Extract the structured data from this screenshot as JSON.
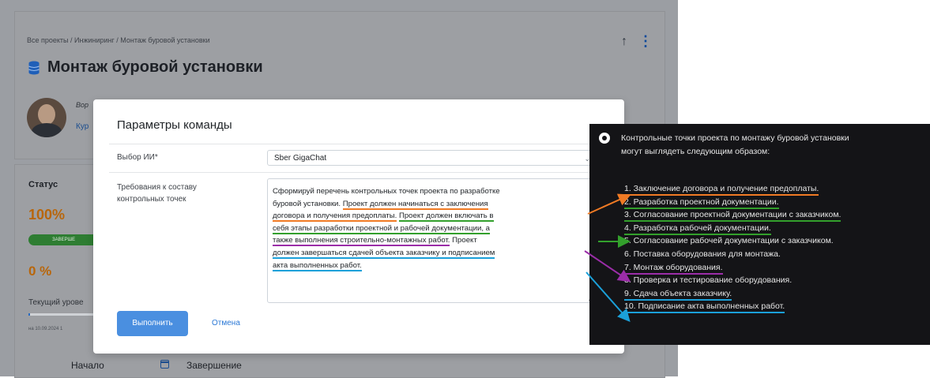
{
  "page": {
    "breadcrumb": "Все проекты / Инжиниринг / Монтаж буровой установки",
    "title": "Монтаж буровой установки",
    "owner_label": "Вор",
    "owner_link": "Кур"
  },
  "icons": {
    "database": "database-icon",
    "up_arrow": "arrow-up-icon",
    "kebab": "kebab-menu-icon",
    "calendar": "calendar-icon"
  },
  "status": {
    "title": "Статус",
    "percent_top": "100%",
    "badge": "ЗАВЕРШЕ",
    "percent_bottom": "0 %",
    "current_level": "Текущий урове",
    "progress_fraction": 0.02,
    "date": "на 10.09.2024 1",
    "start_label": "Начало",
    "end_label": "Завершение"
  },
  "modal": {
    "title": "Параметры команды",
    "ai_label": "Выбор ИИ*",
    "ai_value": "Sber GigaChat",
    "req_label_1": "Требования к составу",
    "req_label_2": "контрольных точек",
    "prompt": {
      "l1": "Сформируй перечень контрольных точек проекта по разработке",
      "l2a": "буровой установки. ",
      "l2b": "Проект должен начинаться с заключения",
      "l3a": "договора и получения предоплаты.",
      "l3b": " ",
      "l3c": "Проект должен включать в",
      "l4": "себя этапы разработки проектной и рабочей документации, а",
      "l5a": "также выполнения строительно-монтажных работ.",
      "l5b": " Проект",
      "l6": "должен завершаться сдачей объекта заказчику и подписанием",
      "l7": "акта выполненных работ."
    },
    "run_button": "Выполнить",
    "cancel_button": "Отмена"
  },
  "response": {
    "intro_1": "Контрольные точки проекта по монтажу буровой установки",
    "intro_2": "могут выглядеть следующим образом:",
    "steps": [
      "1. Заключение договора и получение предоплаты.",
      "2. Разработка проектной документации.",
      "3. Согласование проектной документации с заказчиком.",
      "4. Разработка рабочей документации.",
      "5. Согласование рабочей документации с заказчиком.",
      "6. Поставка оборудования для монтажа.",
      "7. Монтаж оборудования.",
      "8. Проверка и тестирование оборудования.",
      "9. Сдача объекта заказчику.",
      "10. Подписание акта выполненных работ."
    ]
  },
  "colors": {
    "orange": "#f07a24",
    "green": "#33a02c",
    "purple": "#9b2da8",
    "blue": "#1ba0d9",
    "primary": "#4a8fe0"
  }
}
